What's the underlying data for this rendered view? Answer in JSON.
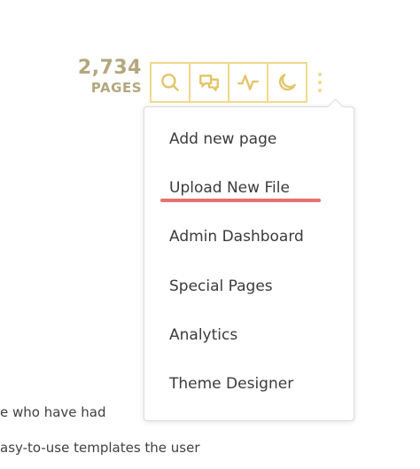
{
  "page_count": {
    "number": "2,734",
    "label": "PAGES"
  },
  "toolbar": {
    "buttons": [
      {
        "icon": "search-icon"
      },
      {
        "icon": "discussion-icon"
      },
      {
        "icon": "activity-icon"
      },
      {
        "icon": "moon-icon"
      }
    ],
    "more_icon": "more-vertical-icon"
  },
  "menu": {
    "items": [
      {
        "label": "Add new page"
      },
      {
        "label": "Upload New File",
        "highlighted": true
      },
      {
        "label": "Admin Dashboard"
      },
      {
        "label": "Special Pages"
      },
      {
        "label": "Analytics"
      },
      {
        "label": "Theme Designer"
      }
    ],
    "highlight_color": "#e8706f"
  },
  "background_text": {
    "line1": "e who have had",
    "line2": "asy-to-use templates the user"
  },
  "colors": {
    "accent": "#f0d98a",
    "count_text": "#b3a77e"
  }
}
